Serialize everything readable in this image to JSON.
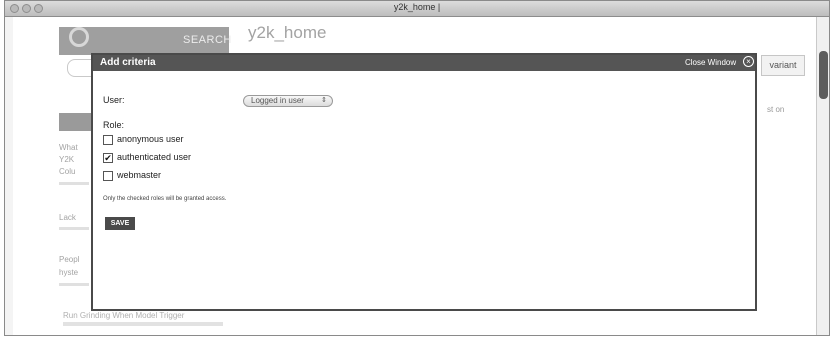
{
  "window": {
    "title": "y2k_home |"
  },
  "page": {
    "title": "y2k_home",
    "search_label": "SEARCH",
    "variant_tab": "variant",
    "right_snippet": "st on"
  },
  "sidebar": {
    "lines": [
      "What",
      "Y2K",
      "Colu",
      "Lack",
      "Peopl",
      "hyste"
    ],
    "bottom_text": "Run Grinding When Model Trigger"
  },
  "modal": {
    "title": "Add criteria",
    "close_label": "Close Window",
    "user_label": "User:",
    "user_select_value": "Logged in user",
    "role_label": "Role:",
    "roles": [
      {
        "label": "anonymous user",
        "checked": false
      },
      {
        "label": "authenticated user",
        "checked": true
      },
      {
        "label": "webmaster",
        "checked": false
      }
    ],
    "note": "Only the checked roles will be granted access.",
    "save_label": "SAVE"
  }
}
